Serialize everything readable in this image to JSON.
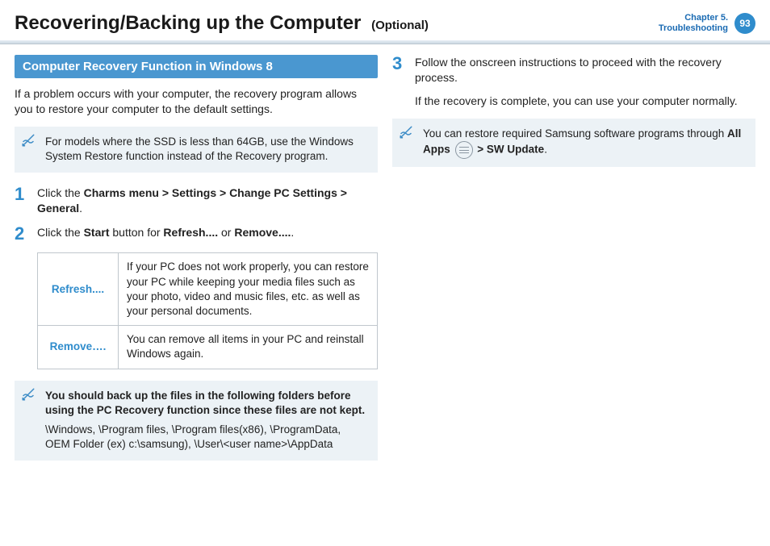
{
  "header": {
    "title": "Recovering/Backing up the Computer",
    "optional": "(Optional)",
    "chapter_line1": "Chapter 5.",
    "chapter_line2": "Troubleshooting",
    "page_number": "93"
  },
  "left": {
    "section_title": "Computer Recovery Function in Windows 8",
    "intro": "If a problem occurs with your computer, the recovery program allows you to restore your computer to the default settings.",
    "note1": "For models where the SSD is less than 64GB, use the Windows System Restore function instead of the Recovery program.",
    "step1_prefix": "Click the ",
    "step1_bold": "Charms menu > Settings > Change PC Settings > General",
    "step1_suffix": ".",
    "step2_prefix": "Click the ",
    "step2_bold1": "Start",
    "step2_mid": " button for ",
    "step2_bold2": "Refresh....",
    "step2_mid2": " or ",
    "step2_bold3": "Remove....",
    "step2_suffix": ".",
    "table": [
      {
        "label": "Refresh....",
        "desc": "If your PC does not work properly, you can restore your PC while keeping your media files such as your photo, video and music files, etc. as well as your personal documents."
      },
      {
        "label": "Remove….",
        "desc": "You can remove all items in your PC and reinstall Windows again."
      }
    ],
    "note2_strong": "You should back up the files in the following folders before using the PC Recovery function since these files are not kept.",
    "note2_body": "\\Windows, \\Program files, \\Program files(x86), \\ProgramData, OEM Folder (ex) c:\\samsung), \\User\\<user name>\\AppData"
  },
  "right": {
    "step3_p1": "Follow the onscreen instructions to proceed with the recovery process.",
    "step3_p2": "If the recovery is complete, you can use your computer normally.",
    "note3_prefix": "You can restore required Samsung software programs through ",
    "note3_bold1": "All Apps",
    "note3_mid": " > ",
    "note3_bold2": "SW Update",
    "note3_suffix": "."
  }
}
